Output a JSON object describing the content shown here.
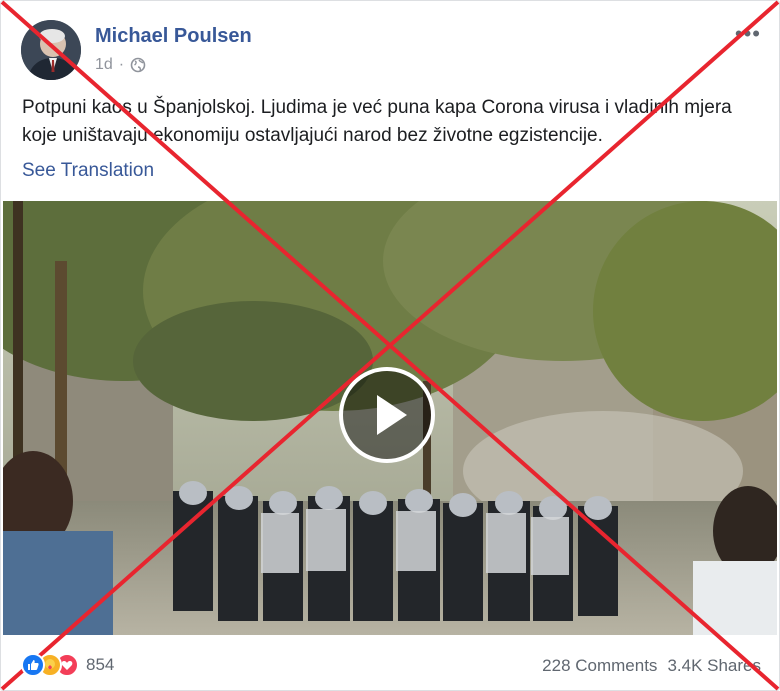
{
  "post": {
    "author": "Michael Poulsen",
    "time": "1d",
    "separator": "·",
    "more_label": "•••",
    "text": "Potpuni kaos u Španjolskoj. Ljudima je već puna kapa Corona virusa i vladinih mjera koje uništavaju ekonomiju ostavljajući narod bez životne egzistencije.",
    "see_translation": "See Translation"
  },
  "video": {
    "play_icon": "play-icon"
  },
  "footer": {
    "reactions": [
      "like-icon",
      "care-icon",
      "love-icon"
    ],
    "reaction_count": "854",
    "comments": "228 Comments",
    "shares": "3.4K Shares"
  },
  "overlay": {
    "cross_color": "#e8252f"
  },
  "colors": {
    "link": "#385898",
    "meta": "#90949c",
    "text": "#1c1e21"
  }
}
